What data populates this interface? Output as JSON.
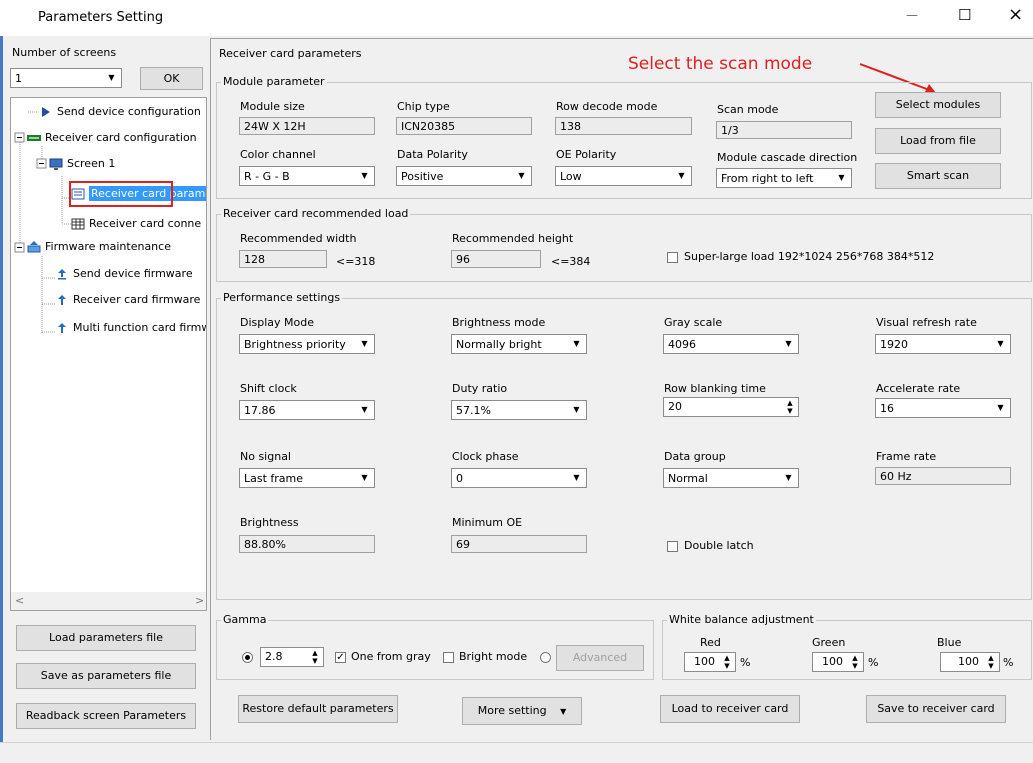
{
  "window": {
    "title": "Parameters Setting",
    "controls": {
      "minimize": "—",
      "maximize": "☐",
      "close": "×"
    }
  },
  "left": {
    "screens_label": "Number of screens",
    "screens_value": "1",
    "ok_label": "OK",
    "tree": [
      {
        "label": "Send device configuration"
      },
      {
        "label": "Receiver card configuration"
      },
      {
        "label": "Screen 1"
      },
      {
        "label": "Receiver card param"
      },
      {
        "label": "Receiver card conne"
      },
      {
        "label": "Firmware maintenance"
      },
      {
        "label": "Send device firmware"
      },
      {
        "label": "Receiver card firmware"
      },
      {
        "label": "Multi function card firmw"
      }
    ],
    "load_params": "Load parameters file",
    "save_params": "Save as parameters file",
    "readback": "Readback screen Parameters"
  },
  "panel": {
    "title": "Receiver card parameters",
    "annotation": "Select the scan mode",
    "annotation_color": "#e02020"
  },
  "module": {
    "title": "Module parameter",
    "module_size_label": "Module size",
    "module_size": "24W X 12H",
    "chip_type_label": "Chip type",
    "chip_type": "ICN20385",
    "row_decode_label": "Row decode mode",
    "row_decode": "138",
    "scan_mode_label": "Scan mode",
    "scan_mode": "1/3",
    "color_channel_label": "Color channel",
    "color_channel": "R - G - B",
    "data_polarity_label": "Data Polarity",
    "data_polarity": "Positive",
    "oe_polarity_label": "OE Polarity",
    "oe_polarity": "Low",
    "cascade_label": "Module cascade direction",
    "cascade": "From right to left",
    "select_modules": "Select modules",
    "load_from_file": "Load from file",
    "smart_scan": "Smart scan"
  },
  "load": {
    "title": "Receiver card recommended load",
    "width_label": "Recommended width",
    "width": "128",
    "width_max": "<=318",
    "height_label": "Recommended height",
    "height": "96",
    "height_max": "<=384",
    "super_large": "Super-large load 192*1024 256*768 384*512"
  },
  "perf": {
    "title": "Performance settings",
    "display_mode_label": "Display Mode",
    "display_mode": "Brightness priority",
    "brightness_mode_label": "Brightness mode",
    "brightness_mode": "Normally bright",
    "gray_scale_label": "Gray scale",
    "gray_scale": "4096",
    "visual_refresh_label": "Visual refresh rate",
    "visual_refresh": "1920",
    "shift_clock_label": "Shift clock",
    "shift_clock": "17.86",
    "duty_ratio_label": "Duty ratio",
    "duty_ratio": "57.1%",
    "row_blanking_label": "Row blanking time",
    "row_blanking": "20",
    "accelerate_label": "Accelerate rate",
    "accelerate": "16",
    "no_signal_label": "No signal",
    "no_signal": "Last frame",
    "clock_phase_label": "Clock phase",
    "clock_phase": "0",
    "data_group_label": "Data group",
    "data_group": "Normal",
    "frame_rate_label": "Frame rate",
    "frame_rate": "60 Hz",
    "brightness_label": "Brightness",
    "brightness": "88.80%",
    "min_oe_label": "Minimum OE",
    "min_oe": "69",
    "double_latch": "Double latch"
  },
  "gamma": {
    "title": "Gamma",
    "value": "2.8",
    "one_from_gray": "One from gray",
    "bright_mode": "Bright mode",
    "advanced": "Advanced"
  },
  "wb": {
    "title": "White balance adjustment",
    "red_label": "Red",
    "red": "100",
    "green_label": "Green",
    "green": "100",
    "blue_label": "Blue",
    "blue": "100",
    "unit": "%"
  },
  "bottom": {
    "restore": "Restore default parameters",
    "more": "More setting",
    "load_to_card": "Load to receiver card",
    "save_to_card": "Save to receiver card"
  }
}
